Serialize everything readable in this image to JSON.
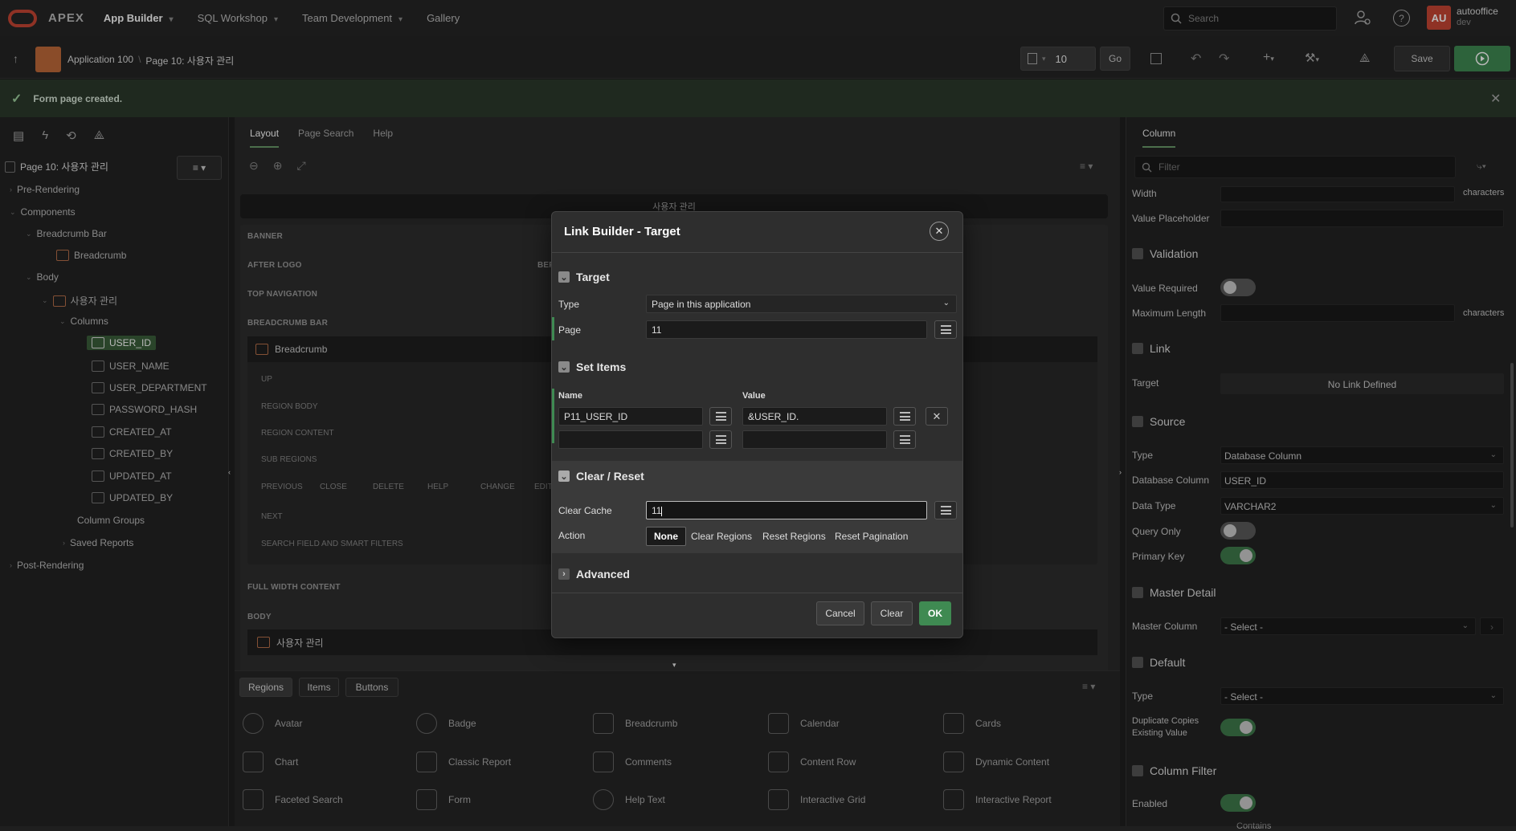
{
  "topnav": {
    "brand": "APEX",
    "items": [
      "App Builder",
      "SQL Workshop",
      "Team Development",
      "Gallery"
    ],
    "search_placeholder": "Search",
    "avatar_initials": "AU",
    "username": "autooffice",
    "workspace": "dev"
  },
  "toolbar": {
    "breadcrumb_app": "Application 100",
    "breadcrumb_page": "Page 10: 사용자 관리",
    "page_number": "10",
    "go_label": "Go",
    "save_label": "Save"
  },
  "banner": {
    "message": "Form page created."
  },
  "left": {
    "root": "Page 10: 사용자 관리",
    "pre": "Pre-Rendering",
    "components": "Components",
    "breadcrumb_bar": "Breadcrumb Bar",
    "breadcrumb": "Breadcrumb",
    "body": "Body",
    "region": "사용자 관리",
    "columns": "Columns",
    "cols": [
      "USER_ID",
      "USER_NAME",
      "USER_DEPARTMENT",
      "PASSWORD_HASH",
      "CREATED_AT",
      "CREATED_BY",
      "UPDATED_AT",
      "UPDATED_BY"
    ],
    "column_groups": "Column Groups",
    "saved_reports": "Saved Reports",
    "post": "Post-Rendering"
  },
  "center": {
    "tabs": [
      "Layout",
      "Page Search",
      "Help"
    ],
    "page_title": "사용자 관리",
    "slots": [
      "BANNER",
      "AFTER LOGO",
      "TOP NAVIGATION",
      "BREADCRUMB BAR",
      "FULL WIDTH CONTENT",
      "BODY"
    ],
    "before_label": "BEF",
    "breadcrumb_region": "Breadcrumb",
    "sub": [
      "UP",
      "REGION BODY",
      "REGION CONTENT",
      "SUB REGIONS",
      "NEXT",
      "SEARCH FIELD AND SMART FILTERS"
    ],
    "buttons_row": [
      "PREVIOUS",
      "CLOSE",
      "DELETE",
      "HELP",
      "CHANGE",
      "EDIT"
    ],
    "body_region": "사용자 관리"
  },
  "gallery": {
    "tabs": [
      "Regions",
      "Items",
      "Buttons"
    ],
    "items": [
      "Avatar",
      "Badge",
      "Breadcrumb",
      "Calendar",
      "Cards",
      "Chart",
      "Classic Report",
      "Comments",
      "Content Row",
      "Dynamic Content",
      "Faceted Search",
      "Form",
      "Help Text",
      "Interactive Grid",
      "Interactive Report"
    ]
  },
  "right": {
    "tab": "Column",
    "filter_placeholder": "Filter",
    "width_label": "Width",
    "characters": "characters",
    "placeholder_label": "Value Placeholder",
    "validation": "Validation",
    "value_required": "Value Required",
    "max_length": "Maximum Length",
    "link": "Link",
    "target": "Target",
    "no_link": "No Link Defined",
    "source": "Source",
    "type_label": "Type",
    "type_value": "Database Column",
    "db_column_label": "Database Column",
    "db_column_value": "USER_ID",
    "data_type_label": "Data Type",
    "data_type_value": "VARCHAR2",
    "query_only": "Query Only",
    "primary_key": "Primary Key",
    "master_detail": "Master Detail",
    "master_column": "Master Column",
    "select": "- Select -",
    "default": "Default",
    "dup_copies": "Duplicate Copies Existing Value",
    "column_filter": "Column Filter",
    "enabled": "Enabled",
    "contains": "Contains"
  },
  "modal": {
    "title": "Link Builder - Target",
    "target_section": "Target",
    "type_label": "Type",
    "type_value": "Page in this application",
    "page_label": "Page",
    "page_value": "11",
    "set_items": "Set Items",
    "name_header": "Name",
    "value_header": "Value",
    "row1_name": "P11_USER_ID",
    "row1_value": "&USER_ID.",
    "clear_reset": "Clear / Reset",
    "clear_cache_label": "Clear Cache",
    "clear_cache_value": "11",
    "action_label": "Action",
    "actions": [
      "None",
      "Clear Regions",
      "Reset Regions",
      "Reset Pagination"
    ],
    "advanced": "Advanced",
    "cancel": "Cancel",
    "clear": "Clear",
    "ok": "OK"
  },
  "colors": {
    "accent_green": "#3f8a52",
    "brand_red": "#c74634"
  }
}
